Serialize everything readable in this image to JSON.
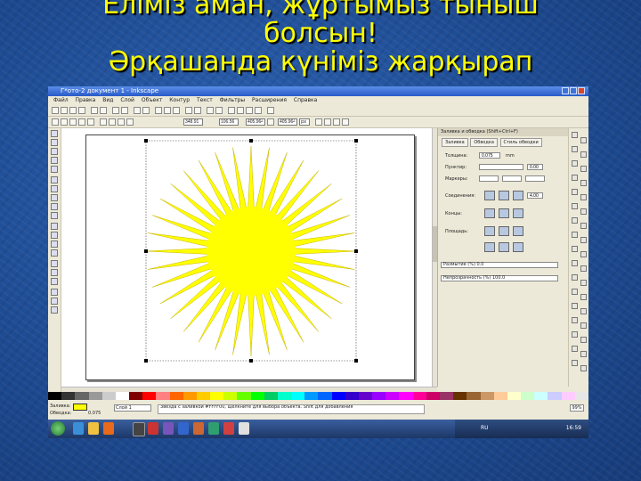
{
  "slide_title": {
    "line1": "Еліміз аман, жұртымыз тыныш",
    "line2": "болсын!",
    "line3": "Әрқашанда күніміз жарқырап"
  },
  "window": {
    "title": "Г*ото-2 документ 1 - Inkscape",
    "menu": [
      "Файл",
      "Правка",
      "Вид",
      "Слой",
      "Объект",
      "Контур",
      "Текст",
      "Фильтры",
      "Расширения",
      "Справка"
    ]
  },
  "toolbar": {
    "x": "348.91",
    "y": "106.56",
    "w": "405.964",
    "h": "405.964",
    "unit": "px"
  },
  "panel": {
    "header": "Заливка и обводка (Shift+Ctrl+F)",
    "tabs": [
      "Заливка",
      "Обводка",
      "Стиль обводки"
    ],
    "width_label": "Толщина:",
    "width_value": "0.075",
    "width_unit": "mm",
    "dash_label": "Пунктир:",
    "dash_value": "0.00",
    "markers_label": "Маркеры:",
    "join_label": "Соединения:",
    "join_value": "4.00",
    "cap_label": "Концы:",
    "ends_label": "Площадь:",
    "blur_label": "Размытие (%)",
    "blur_value": "0.0",
    "opacity_label": "Непрозрачность (%)",
    "opacity_value": "100.0"
  },
  "status": {
    "fill_label": "Заливка:",
    "stroke_label": "Обводка:",
    "stroke_value": "0.075",
    "layer": "Слой 1",
    "message": "Звезда с заливкой #FFFF00, щелкните для выбора объекта. Shift для добавления",
    "zoom": "99%"
  },
  "taskbar": {
    "lang": "RU",
    "clock": "16:59"
  },
  "colors": {
    "sun": "#ffff00",
    "sun_stroke": "#c8b400"
  },
  "icons": [
    "windows-start-icon",
    "ie-icon",
    "explorer-icon",
    "media-icon",
    "inkscape-icon"
  ],
  "palette": [
    "#000000",
    "#333333",
    "#666666",
    "#999999",
    "#cccccc",
    "#ffffff",
    "#800000",
    "#ff0000",
    "#ff8080",
    "#ff6600",
    "#ff9900",
    "#ffcc00",
    "#ffff00",
    "#ccff00",
    "#66ff00",
    "#00ff00",
    "#00cc66",
    "#00ffcc",
    "#00ffff",
    "#0099ff",
    "#0066ff",
    "#0000ff",
    "#3300cc",
    "#6600cc",
    "#9900ff",
    "#cc00ff",
    "#ff00ff",
    "#ff0099",
    "#cc0066",
    "#993366",
    "#663300",
    "#996633",
    "#cc9966",
    "#ffcc99",
    "#ffffcc",
    "#ccffcc",
    "#ccffff",
    "#ccccff",
    "#ffccff",
    "#e6e6e6"
  ]
}
